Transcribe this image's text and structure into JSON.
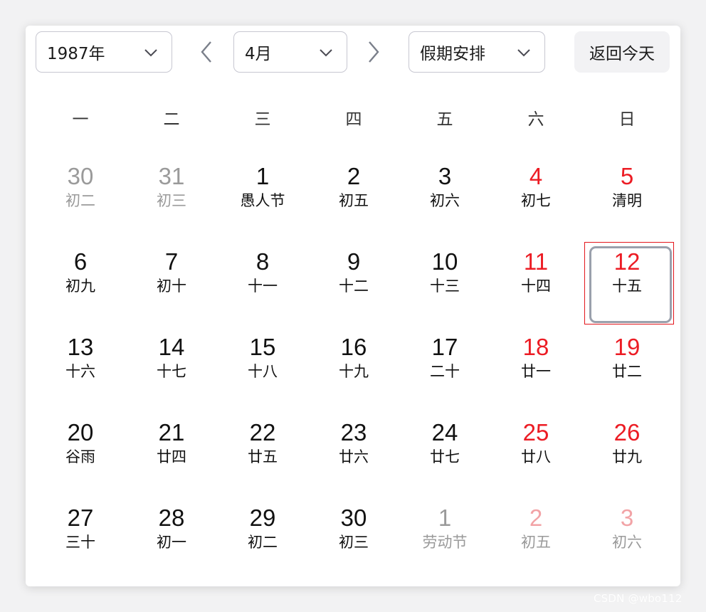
{
  "header": {
    "year_select": "1987年",
    "month_select": "4月",
    "holiday_select": "假期安排",
    "today_button": "返回今天"
  },
  "weekdays": [
    "一",
    "二",
    "三",
    "四",
    "五",
    "六",
    "日"
  ],
  "weeks": [
    [
      {
        "day": "30",
        "lunar": "初二",
        "type": "other"
      },
      {
        "day": "31",
        "lunar": "初三",
        "type": "other"
      },
      {
        "day": "1",
        "lunar": "愚人节",
        "type": "normal"
      },
      {
        "day": "2",
        "lunar": "初五",
        "type": "normal"
      },
      {
        "day": "3",
        "lunar": "初六",
        "type": "normal"
      },
      {
        "day": "4",
        "lunar": "初七",
        "type": "weekend"
      },
      {
        "day": "5",
        "lunar": "清明",
        "type": "weekend"
      }
    ],
    [
      {
        "day": "6",
        "lunar": "初九",
        "type": "normal"
      },
      {
        "day": "7",
        "lunar": "初十",
        "type": "normal"
      },
      {
        "day": "8",
        "lunar": "十一",
        "type": "normal"
      },
      {
        "day": "9",
        "lunar": "十二",
        "type": "normal"
      },
      {
        "day": "10",
        "lunar": "十三",
        "type": "normal"
      },
      {
        "day": "11",
        "lunar": "十四",
        "type": "weekend"
      },
      {
        "day": "12",
        "lunar": "十五",
        "type": "weekend",
        "selected": true
      }
    ],
    [
      {
        "day": "13",
        "lunar": "十六",
        "type": "normal"
      },
      {
        "day": "14",
        "lunar": "十七",
        "type": "normal"
      },
      {
        "day": "15",
        "lunar": "十八",
        "type": "normal"
      },
      {
        "day": "16",
        "lunar": "十九",
        "type": "normal"
      },
      {
        "day": "17",
        "lunar": "二十",
        "type": "normal"
      },
      {
        "day": "18",
        "lunar": "廿一",
        "type": "weekend"
      },
      {
        "day": "19",
        "lunar": "廿二",
        "type": "weekend"
      }
    ],
    [
      {
        "day": "20",
        "lunar": "谷雨",
        "type": "normal"
      },
      {
        "day": "21",
        "lunar": "廿四",
        "type": "normal"
      },
      {
        "day": "22",
        "lunar": "廿五",
        "type": "normal"
      },
      {
        "day": "23",
        "lunar": "廿六",
        "type": "normal"
      },
      {
        "day": "24",
        "lunar": "廿七",
        "type": "normal"
      },
      {
        "day": "25",
        "lunar": "廿八",
        "type": "weekend"
      },
      {
        "day": "26",
        "lunar": "廿九",
        "type": "weekend"
      }
    ],
    [
      {
        "day": "27",
        "lunar": "三十",
        "type": "normal"
      },
      {
        "day": "28",
        "lunar": "初一",
        "type": "normal"
      },
      {
        "day": "29",
        "lunar": "初二",
        "type": "normal"
      },
      {
        "day": "30",
        "lunar": "初三",
        "type": "normal"
      },
      {
        "day": "1",
        "lunar": "劳动节",
        "type": "other"
      },
      {
        "day": "2",
        "lunar": "初五",
        "type": "other-weekend"
      },
      {
        "day": "3",
        "lunar": "初六",
        "type": "other-weekend"
      }
    ]
  ],
  "watermark": "CSDN @wbo112",
  "colors": {
    "weekend": "#ec1c24",
    "other_month": "#9a9a9a",
    "other_month_weekend": "#f2a3a6",
    "selected_outline": "#e3151b",
    "selected_inner": "#9aa0ac"
  },
  "icons": {
    "dropdown": "chevron-down-icon",
    "prev": "chevron-left-icon",
    "next": "chevron-right-icon"
  }
}
